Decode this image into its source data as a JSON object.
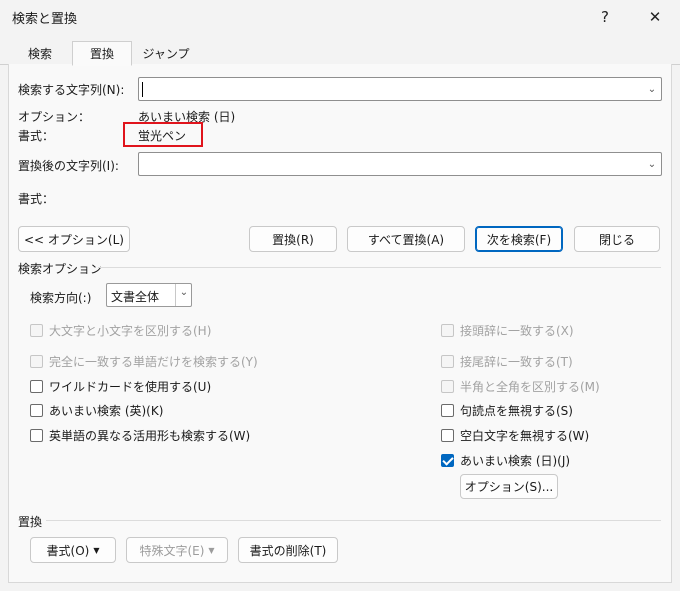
{
  "window": {
    "title": "検索と置換",
    "help_label": "?",
    "close_label": "✕"
  },
  "tabs": [
    {
      "label": "検索"
    },
    {
      "label": "置換"
    },
    {
      "label": "ジャンプ"
    }
  ],
  "find": {
    "label": "検索する文字列(N):",
    "value": "",
    "options_label": "オプション：",
    "options_value": "あいまい検索 (日)",
    "format_label": "書式：",
    "format_value": "蛍光ペン"
  },
  "replace": {
    "label": "置換後の文字列(I):",
    "value": "",
    "format_label": "書式："
  },
  "buttons": {
    "options_toggle": "<< オプション(L)",
    "replace": "置換(R)",
    "replace_all": "すべて置換(A)",
    "find_next": "次を検索(F)",
    "close": "閉じる"
  },
  "search_options": {
    "title": "検索オプション",
    "direction_label": "検索方向(:)",
    "direction_value": "文書全体",
    "left_checks": [
      {
        "label": "大文字と小文字を区別する(H)",
        "checked": false,
        "disabled": true
      },
      {
        "label": "完全に一致する単語だけを検索する(Y)",
        "checked": false,
        "disabled": true
      },
      {
        "label": "ワイルドカードを使用する(U)",
        "checked": false,
        "disabled": false
      },
      {
        "label": "あいまい検索 (英)(K)",
        "checked": false,
        "disabled": false
      },
      {
        "label": "英単語の異なる活用形も検索する(W)",
        "checked": false,
        "disabled": false
      }
    ],
    "right_checks": [
      {
        "label": "接頭辞に一致する(X)",
        "checked": false,
        "disabled": true
      },
      {
        "label": "接尾辞に一致する(T)",
        "checked": false,
        "disabled": true
      },
      {
        "label": "半角と全角を区別する(M)",
        "checked": false,
        "disabled": true
      },
      {
        "label": "句読点を無視する(S)",
        "checked": false,
        "disabled": false
      },
      {
        "label": "空白文字を無視する(W)",
        "checked": false,
        "disabled": false
      },
      {
        "label": "あいまい検索 (日)(J)",
        "checked": true,
        "disabled": false
      }
    ],
    "fuzzy_options_button": "オプション(S)..."
  },
  "replace_group": {
    "title": "置換",
    "format_button": "書式(O)",
    "special_button": "特殊文字(E)",
    "clear_format_button": "書式の削除(T)"
  },
  "colors": {
    "accent": "#0067c0",
    "highlight_box": "#e0141c"
  }
}
